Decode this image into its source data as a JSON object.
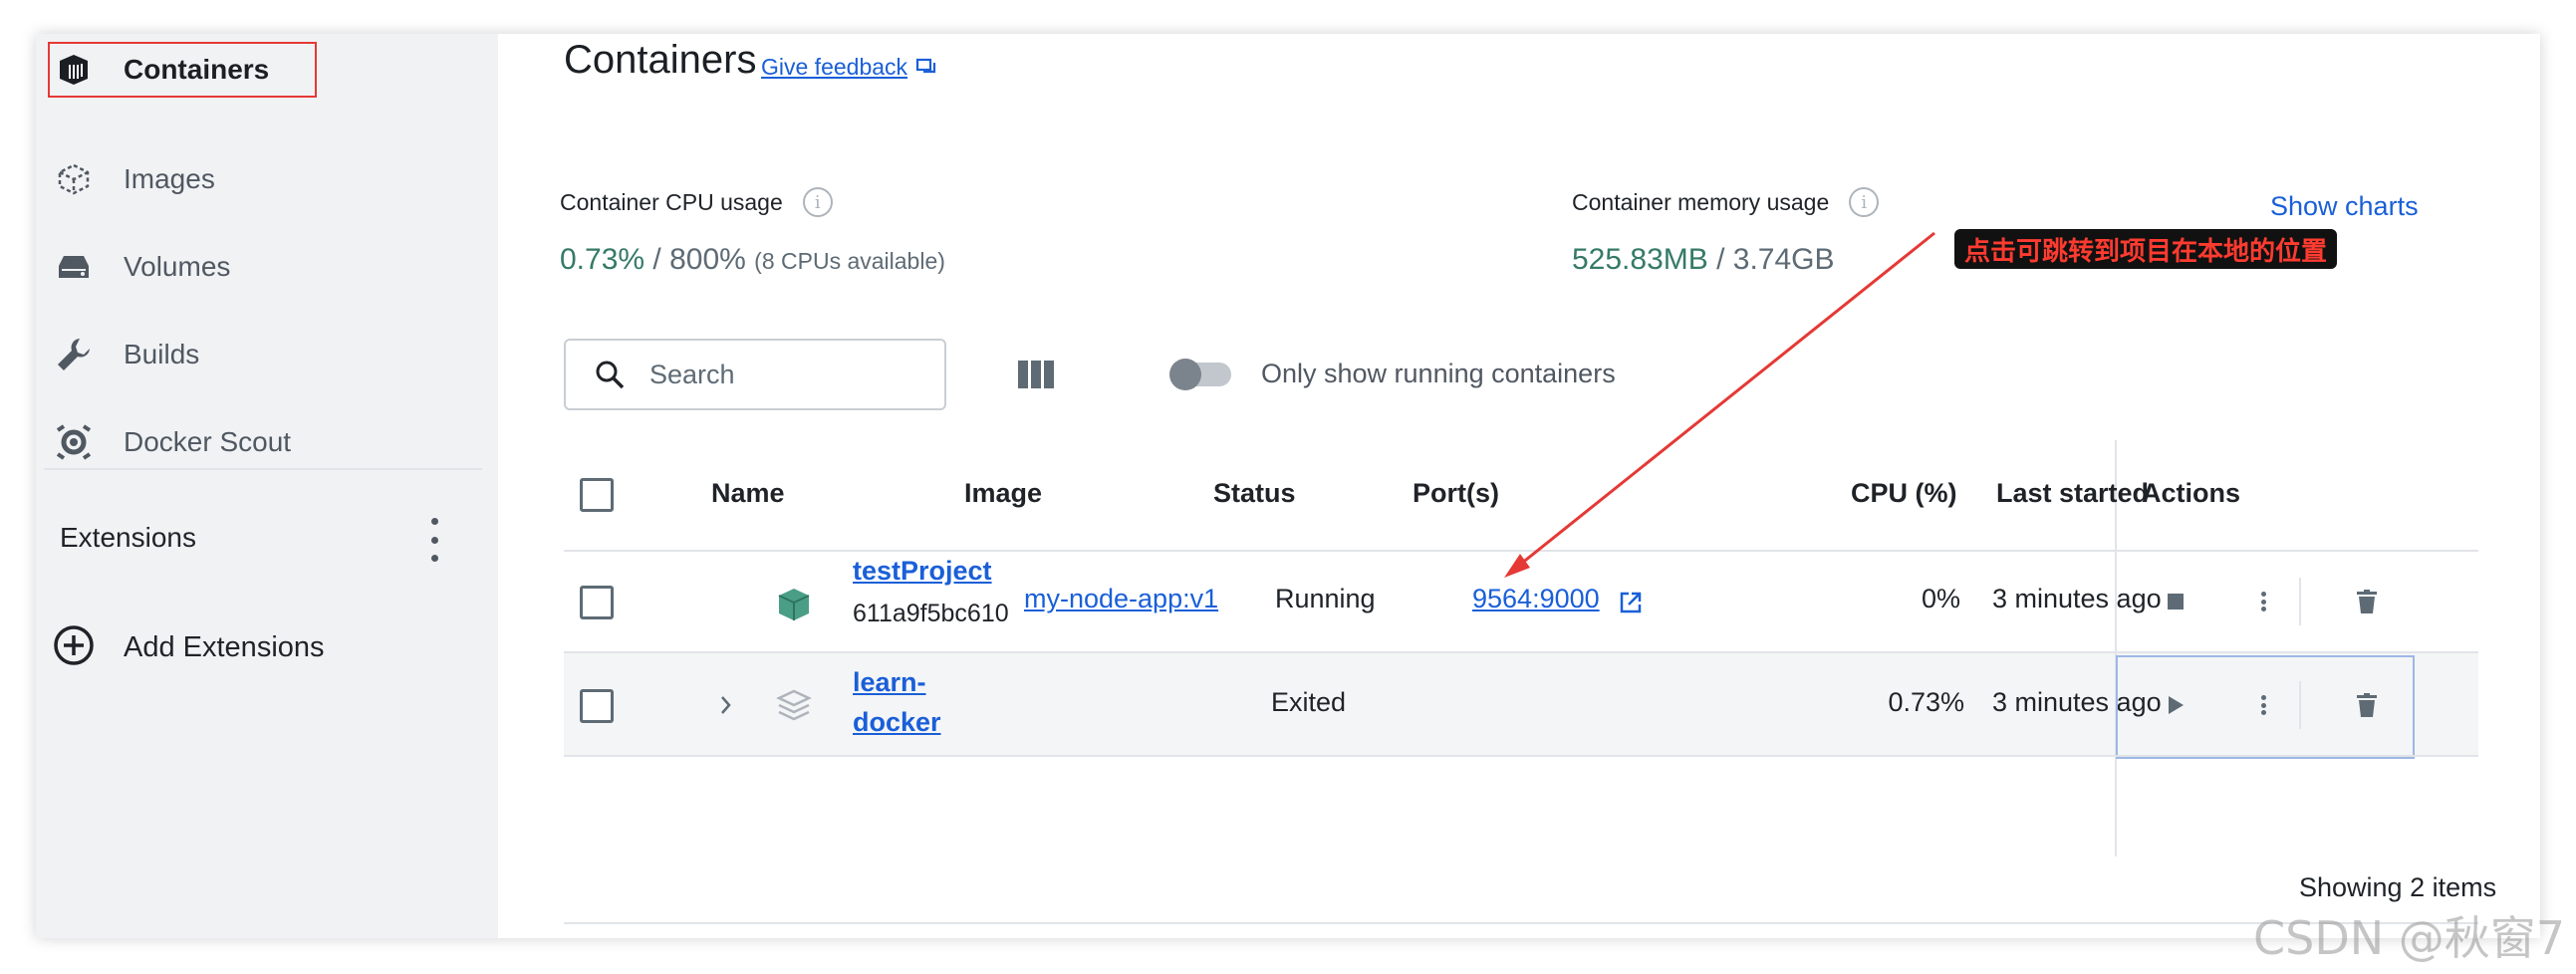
{
  "sidebar": {
    "items": [
      {
        "label": "Containers",
        "icon": "container-icon",
        "active": true
      },
      {
        "label": "Images",
        "icon": "image-icon"
      },
      {
        "label": "Volumes",
        "icon": "volume-icon"
      },
      {
        "label": "Builds",
        "icon": "wrench-icon"
      },
      {
        "label": "Docker Scout",
        "icon": "scout-icon"
      }
    ],
    "extensions_label": "Extensions",
    "add_extensions_label": "Add Extensions"
  },
  "header": {
    "title": "Containers",
    "feedback_label": "Give feedback"
  },
  "stats": {
    "cpu": {
      "label": "Container CPU usage",
      "used": "0.73%",
      "sep": " / ",
      "total": "800%",
      "note": "(8 CPUs available)"
    },
    "memory": {
      "label": "Container memory usage",
      "used": "525.83MB",
      "sep": " / ",
      "total": "3.74GB"
    },
    "show_charts_label": "Show charts"
  },
  "toolbar": {
    "search_placeholder": "Search",
    "toggle_label": "Only show running containers"
  },
  "table": {
    "headers": {
      "name": "Name",
      "image": "Image",
      "status": "Status",
      "ports": "Port(s)",
      "cpu": "CPU (%)",
      "last_started": "Last started",
      "actions": "Actions"
    },
    "rows": [
      {
        "name": "testProject",
        "id": "611a9f5bc610",
        "image": "my-node-app:v1",
        "status": "Running",
        "ports": "9564:9000",
        "cpu": "0%",
        "last_started": "3 minutes ago"
      },
      {
        "name_line1": "learn-",
        "name_line2": "docker",
        "image": "",
        "status": "Exited",
        "ports": "",
        "cpu": "0.73%",
        "last_started": "3 minutes ago"
      }
    ],
    "footer": "Showing 2 items"
  },
  "annotation": {
    "text": "点击可跳转到项目在本地的位置"
  },
  "watermark": "CSDN @秋窗7",
  "colors": {
    "accent": "#1a5fd8",
    "green": "#357a67",
    "annotation_red": "#e53935",
    "sidebar_bg": "#f1f2f4"
  }
}
